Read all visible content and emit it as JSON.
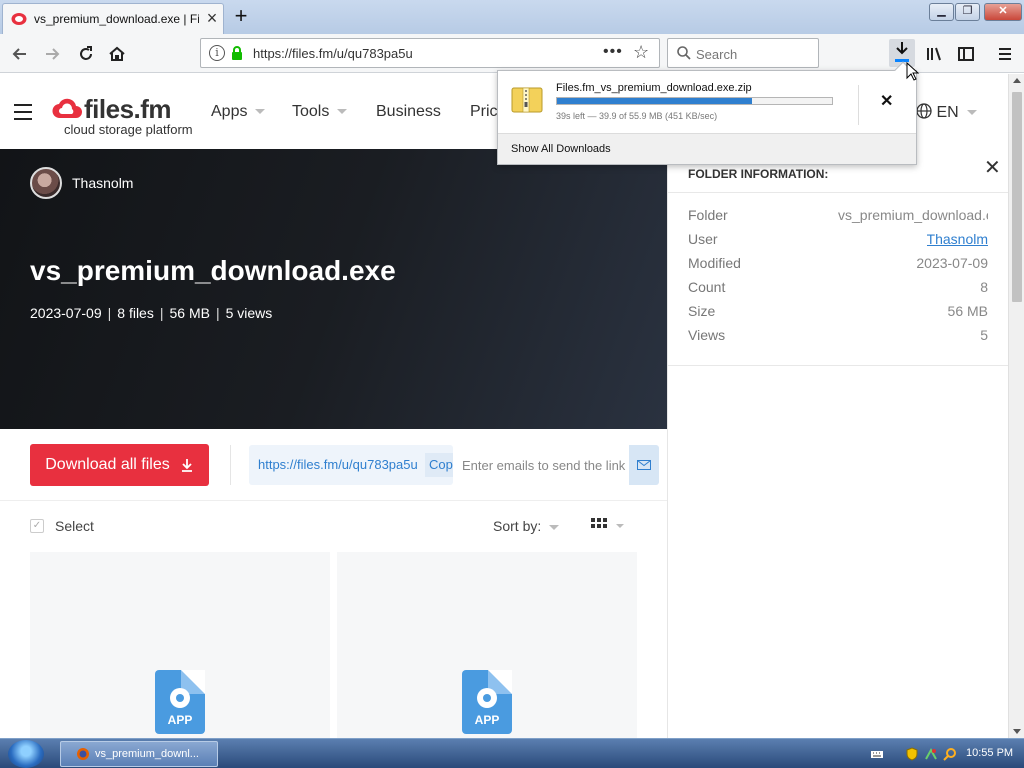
{
  "browser": {
    "tab_title": "vs_premium_download.exe | Files.fm",
    "url": "https://files.fm/u/qu783pa5u",
    "search_placeholder": "Search"
  },
  "site": {
    "logo_name": "files.fm",
    "logo_tagline": "cloud storage platform",
    "menu": [
      "Apps",
      "Tools",
      "Business",
      "Pric"
    ],
    "language": "EN"
  },
  "hero": {
    "username": "Thasnolm",
    "title": "vs_premium_download.exe",
    "date": "2023-07-09",
    "files": "8 files",
    "size": "56 MB",
    "views": "5 views"
  },
  "actions": {
    "download_all": "Download all files",
    "share_link": "https://files.fm/u/qu783pa5u",
    "copy": "Copy",
    "email_placeholder": "Enter emails to send the link"
  },
  "toolbar": {
    "select": "Select",
    "sort_by": "Sort by:"
  },
  "files": [
    {
      "type_label": "APP"
    },
    {
      "type_label": "APP"
    }
  ],
  "folder_info": {
    "heading": "FOLDER INFORMATION:",
    "rows": [
      {
        "label": "Folder",
        "value": "vs_premium_download.exe"
      },
      {
        "label": "User",
        "value": "Thasnolm"
      },
      {
        "label": "Modified",
        "value": "2023-07-09"
      },
      {
        "label": "Count",
        "value": "8"
      },
      {
        "label": "Size",
        "value": "56 MB"
      },
      {
        "label": "Views",
        "value": "5"
      }
    ]
  },
  "download_panel": {
    "file_name": "Files.fm_vs_premium_download.exe.zip",
    "progress_fraction": 0.71,
    "status": "39s left — 39.9 of 55.9 MB (451 KB/sec)",
    "show_all": "Show All Downloads"
  },
  "taskbar": {
    "task_label": "vs_premium_downl...",
    "clock": "10:55 PM"
  },
  "colors": {
    "accent_red": "#e8303f",
    "link_blue": "#2f7fcf",
    "hero_dark": "#121417",
    "progress_blue": "#2f7fcf"
  }
}
